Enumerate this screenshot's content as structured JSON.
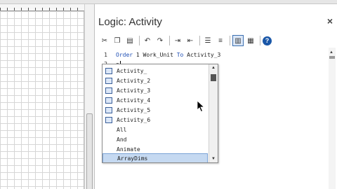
{
  "window": {
    "title": "Logic: Activity",
    "close_glyph": "×"
  },
  "toolbar": {
    "buttons": [
      {
        "name": "cut-icon",
        "glyph": "✂"
      },
      {
        "name": "copy-icon",
        "glyph": "❐"
      },
      {
        "name": "paste-icon",
        "glyph": "▤"
      },
      {
        "name": "undo-icon",
        "glyph": "↶"
      },
      {
        "name": "redo-icon",
        "glyph": "↷"
      },
      {
        "name": "indent-icon",
        "glyph": "⇥"
      },
      {
        "name": "outdent-icon",
        "glyph": "⇤"
      },
      {
        "name": "comment-icon",
        "glyph": "☰"
      },
      {
        "name": "uncomment-icon",
        "glyph": "≡"
      },
      {
        "name": "toggle-icon",
        "glyph": "▥"
      },
      {
        "name": "list-icon",
        "glyph": "▦"
      }
    ],
    "help_glyph": "?"
  },
  "editor": {
    "lines": [
      {
        "num": "1",
        "keyword1": "Order",
        "text1": " 1 Work_Unit ",
        "keyword2": "To",
        "text2": " Activity_3"
      },
      {
        "num": "2",
        "text": "a"
      }
    ]
  },
  "autocomplete": {
    "items": [
      {
        "label": "Activity_",
        "icon": true
      },
      {
        "label": "Activity_2",
        "icon": true
      },
      {
        "label": "Activity_3",
        "icon": true
      },
      {
        "label": "Activity_4",
        "icon": true
      },
      {
        "label": "Activity_5",
        "icon": true
      },
      {
        "label": "Activity_6",
        "icon": true
      },
      {
        "label": "All",
        "icon": false
      },
      {
        "label": "And",
        "icon": false
      },
      {
        "label": "Animate",
        "icon": false
      },
      {
        "label": "ArrayDims",
        "icon": false,
        "selected": true
      }
    ]
  },
  "colors": {
    "keyword": "#1f4fb5",
    "selection": "#c5d9f1",
    "help": "#1a57a8"
  }
}
